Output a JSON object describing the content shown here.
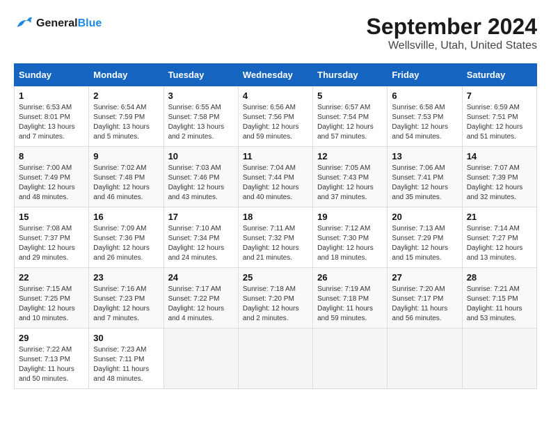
{
  "header": {
    "logo_line1": "General",
    "logo_line2": "Blue",
    "month": "September 2024",
    "location": "Wellsville, Utah, United States"
  },
  "days_of_week": [
    "Sunday",
    "Monday",
    "Tuesday",
    "Wednesday",
    "Thursday",
    "Friday",
    "Saturday"
  ],
  "weeks": [
    [
      {
        "day": "1",
        "sunrise": "6:53 AM",
        "sunset": "8:01 PM",
        "daylight": "13 hours and 7 minutes."
      },
      {
        "day": "2",
        "sunrise": "6:54 AM",
        "sunset": "7:59 PM",
        "daylight": "13 hours and 5 minutes."
      },
      {
        "day": "3",
        "sunrise": "6:55 AM",
        "sunset": "7:58 PM",
        "daylight": "13 hours and 2 minutes."
      },
      {
        "day": "4",
        "sunrise": "6:56 AM",
        "sunset": "7:56 PM",
        "daylight": "12 hours and 59 minutes."
      },
      {
        "day": "5",
        "sunrise": "6:57 AM",
        "sunset": "7:54 PM",
        "daylight": "12 hours and 57 minutes."
      },
      {
        "day": "6",
        "sunrise": "6:58 AM",
        "sunset": "7:53 PM",
        "daylight": "12 hours and 54 minutes."
      },
      {
        "day": "7",
        "sunrise": "6:59 AM",
        "sunset": "7:51 PM",
        "daylight": "12 hours and 51 minutes."
      }
    ],
    [
      {
        "day": "8",
        "sunrise": "7:00 AM",
        "sunset": "7:49 PM",
        "daylight": "12 hours and 48 minutes."
      },
      {
        "day": "9",
        "sunrise": "7:02 AM",
        "sunset": "7:48 PM",
        "daylight": "12 hours and 46 minutes."
      },
      {
        "day": "10",
        "sunrise": "7:03 AM",
        "sunset": "7:46 PM",
        "daylight": "12 hours and 43 minutes."
      },
      {
        "day": "11",
        "sunrise": "7:04 AM",
        "sunset": "7:44 PM",
        "daylight": "12 hours and 40 minutes."
      },
      {
        "day": "12",
        "sunrise": "7:05 AM",
        "sunset": "7:43 PM",
        "daylight": "12 hours and 37 minutes."
      },
      {
        "day": "13",
        "sunrise": "7:06 AM",
        "sunset": "7:41 PM",
        "daylight": "12 hours and 35 minutes."
      },
      {
        "day": "14",
        "sunrise": "7:07 AM",
        "sunset": "7:39 PM",
        "daylight": "12 hours and 32 minutes."
      }
    ],
    [
      {
        "day": "15",
        "sunrise": "7:08 AM",
        "sunset": "7:37 PM",
        "daylight": "12 hours and 29 minutes."
      },
      {
        "day": "16",
        "sunrise": "7:09 AM",
        "sunset": "7:36 PM",
        "daylight": "12 hours and 26 minutes."
      },
      {
        "day": "17",
        "sunrise": "7:10 AM",
        "sunset": "7:34 PM",
        "daylight": "12 hours and 24 minutes."
      },
      {
        "day": "18",
        "sunrise": "7:11 AM",
        "sunset": "7:32 PM",
        "daylight": "12 hours and 21 minutes."
      },
      {
        "day": "19",
        "sunrise": "7:12 AM",
        "sunset": "7:30 PM",
        "daylight": "12 hours and 18 minutes."
      },
      {
        "day": "20",
        "sunrise": "7:13 AM",
        "sunset": "7:29 PM",
        "daylight": "12 hours and 15 minutes."
      },
      {
        "day": "21",
        "sunrise": "7:14 AM",
        "sunset": "7:27 PM",
        "daylight": "12 hours and 13 minutes."
      }
    ],
    [
      {
        "day": "22",
        "sunrise": "7:15 AM",
        "sunset": "7:25 PM",
        "daylight": "12 hours and 10 minutes."
      },
      {
        "day": "23",
        "sunrise": "7:16 AM",
        "sunset": "7:23 PM",
        "daylight": "12 hours and 7 minutes."
      },
      {
        "day": "24",
        "sunrise": "7:17 AM",
        "sunset": "7:22 PM",
        "daylight": "12 hours and 4 minutes."
      },
      {
        "day": "25",
        "sunrise": "7:18 AM",
        "sunset": "7:20 PM",
        "daylight": "12 hours and 2 minutes."
      },
      {
        "day": "26",
        "sunrise": "7:19 AM",
        "sunset": "7:18 PM",
        "daylight": "11 hours and 59 minutes."
      },
      {
        "day": "27",
        "sunrise": "7:20 AM",
        "sunset": "7:17 PM",
        "daylight": "11 hours and 56 minutes."
      },
      {
        "day": "28",
        "sunrise": "7:21 AM",
        "sunset": "7:15 PM",
        "daylight": "11 hours and 53 minutes."
      }
    ],
    [
      {
        "day": "29",
        "sunrise": "7:22 AM",
        "sunset": "7:13 PM",
        "daylight": "11 hours and 50 minutes."
      },
      {
        "day": "30",
        "sunrise": "7:23 AM",
        "sunset": "7:11 PM",
        "daylight": "11 hours and 48 minutes."
      },
      null,
      null,
      null,
      null,
      null
    ]
  ]
}
